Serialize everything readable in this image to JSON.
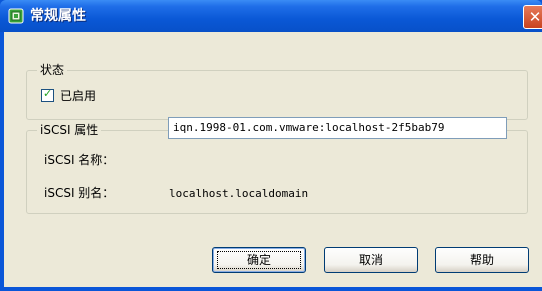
{
  "window": {
    "title": "常规属性",
    "close_glyph": "✕",
    "title_icon": "properties-icon"
  },
  "status_group": {
    "legend": "状态",
    "enabled_checkbox": {
      "label": "已启用",
      "checked": true
    }
  },
  "iscsi_group": {
    "legend": "iSCSI 属性",
    "name_label": "iSCSI 名称：",
    "name_value": "iqn.1998-01.com.vmware:localhost-2f5bab79",
    "alias_label": "iSCSI 别名：",
    "alias_value": "localhost.localdomain"
  },
  "buttons": {
    "ok": "确定",
    "cancel": "取消",
    "help": "帮助"
  },
  "colors": {
    "titlebar": "#0a58d6",
    "dialog_bg": "#ece9d8",
    "close_button": "#c9431f"
  }
}
